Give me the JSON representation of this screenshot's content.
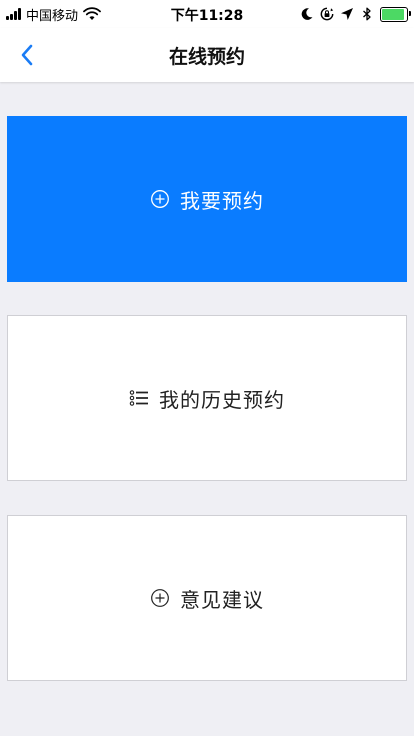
{
  "status_bar": {
    "carrier": "中国移动",
    "time": "下午11:28",
    "battery_level": 0.9,
    "battery_color": "#4cd964"
  },
  "nav": {
    "title": "在线预约",
    "back_icon": "chevron-left-icon",
    "accent_color": "#1a7cf5"
  },
  "actions": {
    "book": {
      "label": "我要预约",
      "icon": "plus-circle-icon",
      "background": "#0a7cff"
    },
    "history": {
      "label": "我的历史预约",
      "icon": "list-icon"
    },
    "feedback": {
      "label": "意见建议",
      "icon": "plus-circle-icon"
    }
  }
}
